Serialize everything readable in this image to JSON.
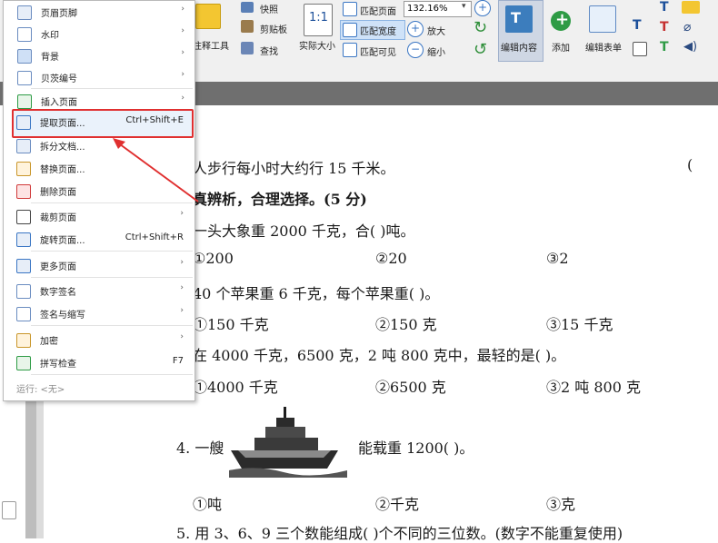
{
  "ribbon": {
    "annotate_tools_label": "注释工具",
    "snapshot_label": "快照",
    "clipboard_label": "剪贴板",
    "find_label": "查找",
    "actual_size_label": "实际大小",
    "fit_page_label": "匹配页面",
    "fit_width_label": "匹配宽度",
    "fit_visible_label": "匹配可见",
    "zoom_value": "132.16%",
    "zoom_in_label": "放大",
    "zoom_out_label": "缩小",
    "edit_content_label": "编辑内容",
    "add_label": "添加",
    "edit_form_label": "编辑表单"
  },
  "menu": {
    "items": [
      {
        "label": "页眉页脚",
        "arrow": "›"
      },
      {
        "label": "水印",
        "arrow": "›"
      },
      {
        "label": "背景",
        "arrow": "›"
      },
      {
        "label": "贝茨编号",
        "arrow": "›"
      },
      {
        "label": "插入页面",
        "arrow": "›"
      },
      {
        "label": "提取页面...",
        "shortcut": "Ctrl+Shift+E"
      },
      {
        "label": "拆分文档..."
      },
      {
        "label": "替换页面..."
      },
      {
        "label": "删除页面"
      },
      {
        "label": "裁剪页面",
        "arrow": "›"
      },
      {
        "label": "旋转页面...",
        "shortcut": "Ctrl+Shift+R"
      },
      {
        "label": "更多页面",
        "arrow": "›"
      },
      {
        "label": "数字签名",
        "arrow": "›"
      },
      {
        "label": "签名与缩写",
        "arrow": "›"
      },
      {
        "label": "加密",
        "arrow": "›"
      },
      {
        "label": "拼写检查",
        "shortcut": "F7"
      }
    ],
    "footer": "运行:  <无>"
  },
  "document": {
    "lines": [
      "人步行每小时大约行 15 千米。",
      "(",
      "真辨析，合理选择。(5 分)",
      "一头大象重 2000 千克，合(        )吨。",
      "①200",
      "②20",
      "③2",
      "40 个苹果重 6 千克，每个苹果重(        )。",
      "①150 千克",
      "②150 克",
      "③15 千克",
      "在 4000 千克，6500 克，2 吨 800 克中，最轻的是(        )。",
      "①4000 千克",
      "②6500 克",
      "③2 吨 800 克",
      "4. 一艘",
      "能载重 1200(        )。",
      "①吨",
      "②千克",
      "③克",
      "5. 用 3、6、9 三个数能组成(        )个不同的三位数。(数字不能重复使用)"
    ]
  },
  "colors": {
    "highlight_border": "#e03030",
    "arrow": "#e03030",
    "dark_bar": "#6f6f6f"
  }
}
